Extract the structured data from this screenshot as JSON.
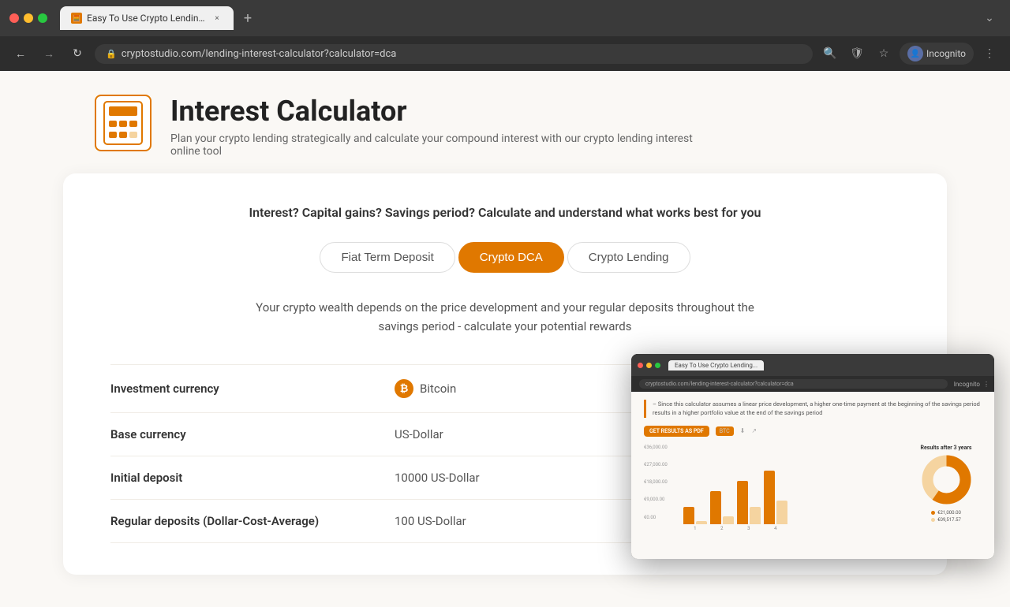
{
  "browser": {
    "tab_title": "Easy To Use Crypto Lending In...",
    "tab_close": "×",
    "new_tab": "+",
    "chevron": "⌄",
    "back": "←",
    "forward": "→",
    "refresh": "↻",
    "address": "cryptostudio.com/lending-interest-calculator?calculator=dca",
    "profile_label": "Incognito",
    "nav_buttons": [
      "🔍",
      "🛡",
      "★",
      "⋮"
    ]
  },
  "page": {
    "header": {
      "title": "Interest Calculator",
      "description": "Plan your crypto lending strategically and calculate your compound interest with our crypto lending interest online tool"
    },
    "card": {
      "subtitle": "Interest? Capital gains? Savings period? Calculate and understand what works best for you",
      "tabs": [
        {
          "label": "Fiat Term Deposit",
          "active": false
        },
        {
          "label": "Crypto DCA",
          "active": true
        },
        {
          "label": "Crypto Lending",
          "active": false
        }
      ],
      "tab_description": "Your crypto wealth depends on the price development and your regular deposits throughout the savings period - calculate your potential rewards",
      "fields": [
        {
          "label": "Investment currency",
          "value": "Bitcoin",
          "type": "bitcoin",
          "has_arrow": true,
          "has_help": true
        },
        {
          "label": "Base currency",
          "value": "US-Dollar",
          "type": "text",
          "has_arrow": false,
          "has_help": false
        },
        {
          "label": "Initial deposit",
          "value": "10000  US-Dollar",
          "type": "text",
          "has_arrow": false,
          "has_help": false
        },
        {
          "label": "Regular deposits (Dollar-Cost-Average)",
          "value": "100  US-Dollar",
          "type": "text",
          "has_arrow": false,
          "has_help": false
        }
      ]
    },
    "popup": {
      "info_text": "– Since this calculator assumes a linear price development, a higher one-time payment at the beginning of the savings period results in a higher portfolio value at the end of the savings period",
      "results_btn": "GET RESULTS AS PDF",
      "chart_labels": [
        "1",
        "2",
        "3",
        "4"
      ],
      "y_labels": [
        "€36,000.00",
        "€27,000.00",
        "€18,000.00",
        "€9,000.00",
        "€0.00"
      ],
      "result_label": "Results after 3 years",
      "result_values": [
        "● €21,000.00",
        "● €09,517.57"
      ]
    }
  }
}
